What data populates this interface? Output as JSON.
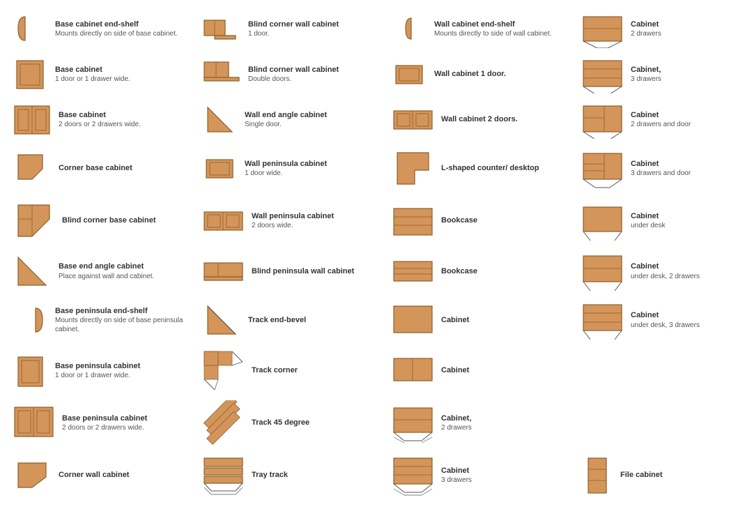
{
  "items": [
    {
      "id": "base-cabinet-end-shelf",
      "name": "Base cabinet end-shelf",
      "desc": "Mounts directly on side of base cabinet.",
      "col": 0
    },
    {
      "id": "base-cabinet-1door",
      "name": "Base cabinet",
      "desc": "1 door or 1 drawer wide.",
      "col": 0
    },
    {
      "id": "base-cabinet-2door",
      "name": "Base cabinet",
      "desc": "2 doors or 2 drawers wide.",
      "col": 0
    },
    {
      "id": "corner-base-cabinet",
      "name": "Corner base cabinet",
      "desc": "",
      "col": 0
    },
    {
      "id": "blind-corner-base-cabinet",
      "name": "Blind corner base cabinet",
      "desc": "",
      "col": 0
    },
    {
      "id": "base-end-angle-cabinet",
      "name": "Base end angle cabinet",
      "desc": "Place against wall and cabinet.",
      "col": 0
    },
    {
      "id": "base-peninsula-end-shelf",
      "name": "Base peninsula end-shelf",
      "desc": "Mounts directly on side of base peninsula cabinet.",
      "col": 0
    },
    {
      "id": "base-peninsula-cabinet-1door",
      "name": "Base peninsula cabinet",
      "desc": "1 door or 1 drawer wide.",
      "col": 0
    },
    {
      "id": "base-peninsula-cabinet-2door",
      "name": "Base peninsula cabinet",
      "desc": "2 doors or 2 drawers wide.",
      "col": 0
    },
    {
      "id": "corner-wall-cabinet",
      "name": "Corner wall cabinet",
      "desc": "",
      "col": 0
    },
    {
      "id": "blind-corner-wall-cabinet-1door",
      "name": "Blind corner wall cabinet",
      "desc": "1 door.",
      "col": 1
    },
    {
      "id": "blind-corner-wall-cabinet-double",
      "name": "Blind corner wall cabinet",
      "desc": "Double doors.",
      "col": 1
    },
    {
      "id": "wall-end-angle-cabinet",
      "name": "Wall end angle cabinet",
      "desc": "Single door.",
      "col": 1
    },
    {
      "id": "wall-peninsula-cabinet-1door",
      "name": "Wall peninsula cabinet",
      "desc": "1 door wide.",
      "col": 1
    },
    {
      "id": "wall-peninsula-cabinet-2door",
      "name": "Wall peninsula cabinet",
      "desc": "2 doors wide.",
      "col": 1
    },
    {
      "id": "blind-peninsula-wall-cabinet",
      "name": "Blind peninsula wall cabinet",
      "desc": "",
      "col": 1
    },
    {
      "id": "track-end-bevel",
      "name": "Track end-bevel",
      "desc": "",
      "col": 1
    },
    {
      "id": "track-corner",
      "name": "Track corner",
      "desc": "",
      "col": 1
    },
    {
      "id": "track-45-degree",
      "name": "Track 45 degree",
      "desc": "",
      "col": 1
    },
    {
      "id": "tray-track",
      "name": "Tray track",
      "desc": "",
      "col": 1
    },
    {
      "id": "wall-cabinet-end-shelf",
      "name": "Wall cabinet end-shelf",
      "desc": "Mounts directly to side of wall cabinet.",
      "col": 2
    },
    {
      "id": "wall-cabinet-1door",
      "name": "Wall cabinet 1 door.",
      "desc": "",
      "col": 2
    },
    {
      "id": "wall-cabinet-2doors",
      "name": "Wall cabinet 2 doors.",
      "desc": "",
      "col": 2
    },
    {
      "id": "l-shaped-counter",
      "name": "L-shaped counter/ desktop",
      "desc": "",
      "col": 2
    },
    {
      "id": "bookcase-1",
      "name": "Bookcase",
      "desc": "",
      "col": 2
    },
    {
      "id": "bookcase-2",
      "name": "Bookcase",
      "desc": "",
      "col": 2
    },
    {
      "id": "cabinet-plain",
      "name": "Cabinet",
      "desc": "",
      "col": 2
    },
    {
      "id": "cabinet-plain-2",
      "name": "Cabinet",
      "desc": "",
      "col": 2
    },
    {
      "id": "cabinet-2drawers",
      "name": "Cabinet,",
      "desc": "2 drawers",
      "col": 2
    },
    {
      "id": "cabinet-3drawers",
      "name": "Cabinet",
      "desc": "3 drawers",
      "col": 2
    },
    {
      "id": "cabinet-2drawers-right",
      "name": "Cabinet",
      "desc": "2 drawers",
      "col": 3
    },
    {
      "id": "cabinet-3drawers-right",
      "name": "Cabinet,",
      "desc": "3 drawers",
      "col": 3
    },
    {
      "id": "cabinet-2drawers-door",
      "name": "Cabinet",
      "desc": "2 drawers and door",
      "col": 3
    },
    {
      "id": "cabinet-3drawers-door",
      "name": "Cabinet",
      "desc": "3 drawers and door",
      "col": 3
    },
    {
      "id": "cabinet-under-desk",
      "name": "Cabinet",
      "desc": "under desk",
      "col": 3
    },
    {
      "id": "cabinet-under-desk-2drawers",
      "name": "Cabinet",
      "desc": "under desk, 2 drawers",
      "col": 3
    },
    {
      "id": "cabinet-under-desk-3drawers",
      "name": "Cabinet",
      "desc": "under desk, 3 drawers",
      "col": 3
    },
    {
      "id": "file-cabinet",
      "name": "File cabinet",
      "desc": "",
      "col": 3
    }
  ]
}
